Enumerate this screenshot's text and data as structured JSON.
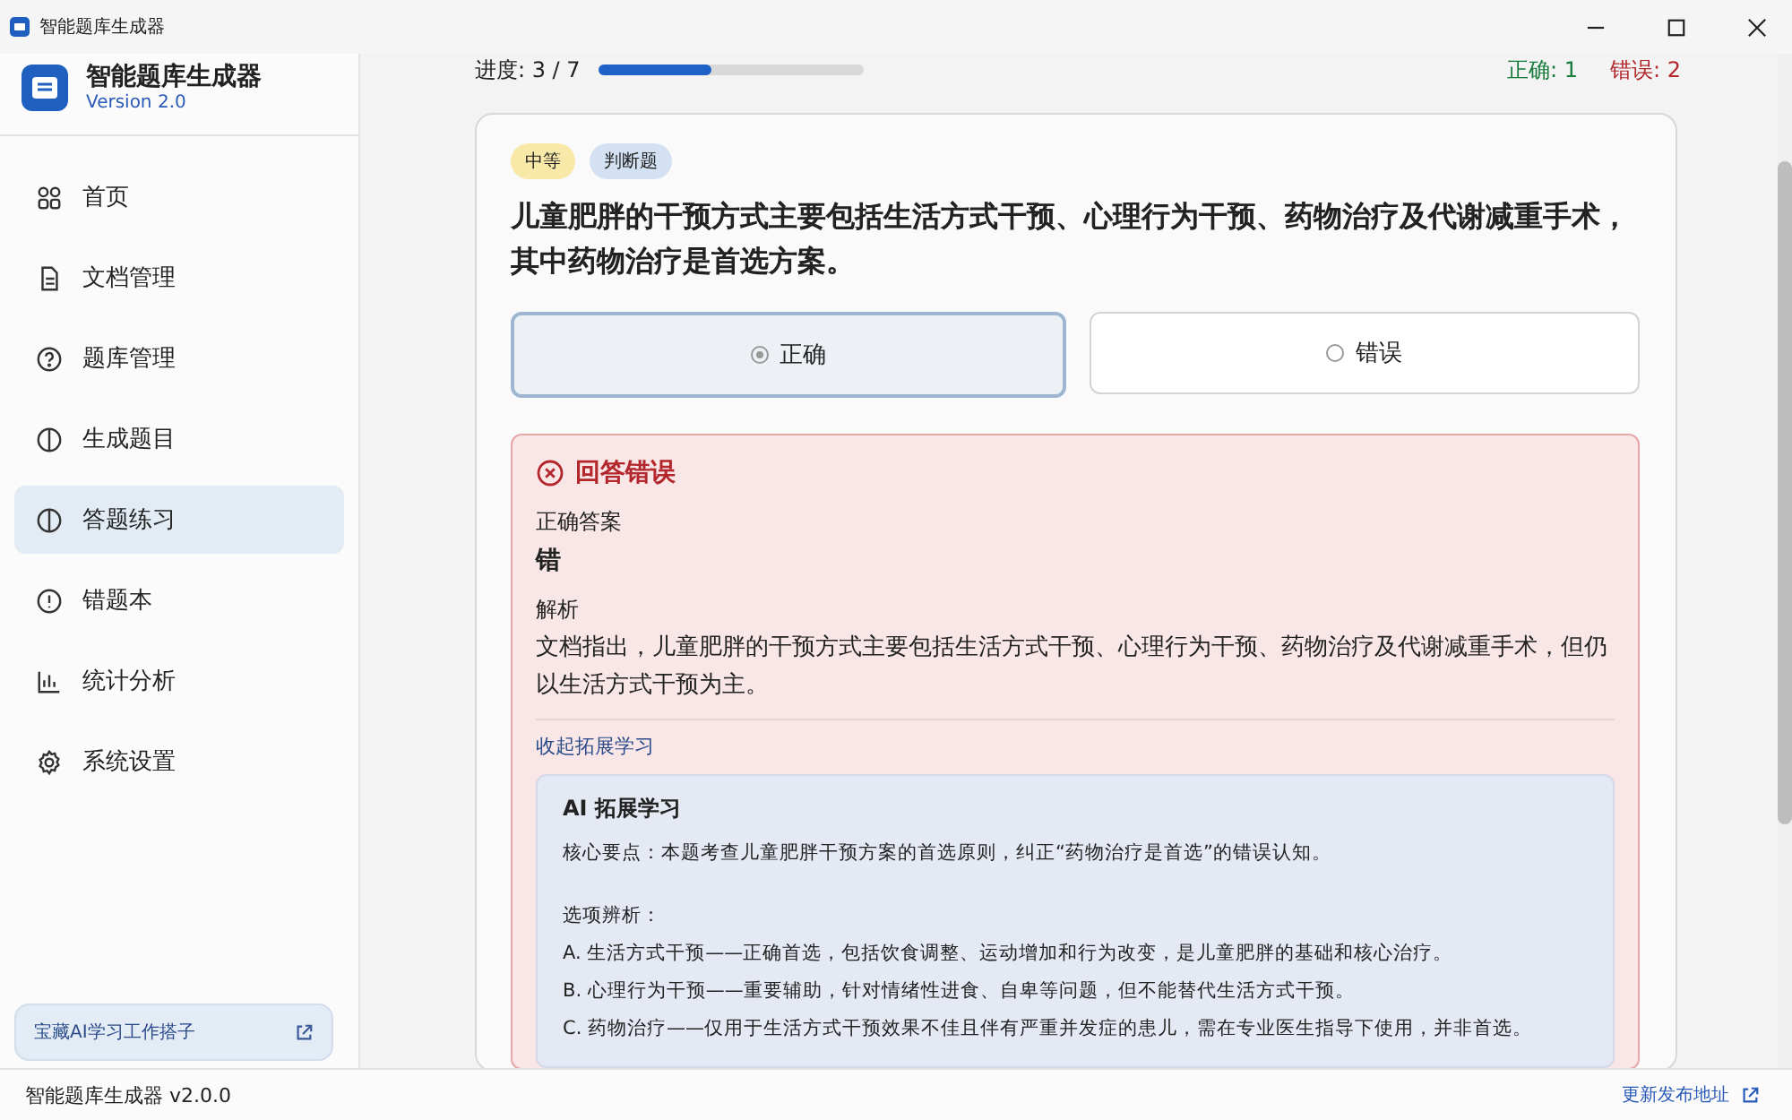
{
  "window": {
    "title": "智能题库生成器"
  },
  "sidebar": {
    "app_name": "智能题库生成器",
    "version": "Version 2.0",
    "items": [
      {
        "label": "首页",
        "kind": "grid",
        "selected": false
      },
      {
        "label": "文档管理",
        "kind": "doc",
        "selected": false
      },
      {
        "label": "题库管理",
        "kind": "help",
        "selected": false
      },
      {
        "label": "生成题目",
        "kind": "half",
        "selected": false
      },
      {
        "label": "答题练习",
        "kind": "half",
        "selected": true
      },
      {
        "label": "错题本",
        "kind": "alert",
        "selected": false
      },
      {
        "label": "统计分析",
        "kind": "chart",
        "selected": false
      },
      {
        "label": "系统设置",
        "kind": "gear",
        "selected": false
      }
    ],
    "promo_link": "宝藏AI学习工作搭子"
  },
  "progress": {
    "label": "进度: 3 / 7",
    "level": 0.43,
    "correct": "正确: 1",
    "wrong": "错误: 2"
  },
  "question": {
    "tags": [
      {
        "label": "中等",
        "color": "#f8e9a8"
      },
      {
        "label": "判断题",
        "color": "#d3e1f3"
      }
    ],
    "text": "儿童肥胖的干预方式主要包括生活方式干预、心理行为干预、药物治疗及代谢减重手术，其中药物治疗是首选方案。",
    "options": [
      {
        "label": "正确",
        "selected": true
      },
      {
        "label": "错误",
        "selected": false
      }
    ]
  },
  "feedback": {
    "result": "回答错误",
    "answer_label": "正确答案",
    "answer": "错",
    "analysis_label": "解析",
    "analysis": "文档指出，儿童肥胖的干预方式主要包括生活方式干预、心理行为干预、药物治疗及代谢减重手术，但仍以生活方式干预为主。",
    "toggle": "收起拓展学习",
    "ai": {
      "title": "AI 拓展学习",
      "summary": "核心要点：本题考查儿童肥胖干预方案的首选原则，纠正“药物治疗是首选”的错误认知。",
      "lines": [
        "选项辨析：",
        "A. 生活方式干预——正确首选，包括饮食调整、运动增加和行为改变，是儿童肥胖的基础和核心治疗。",
        "B. 心理行为干预——重要辅助，针对情绪性进食、自卑等问题，但不能替代生活方式干预。",
        "C. 药物治疗——仅用于生活方式干预效果不佳且伴有严重并发症的患儿，需在专业医生指导下使用，并非首选。"
      ]
    }
  },
  "status_bar": {
    "version": "智能题库生成器 v2.0.0",
    "link": "更新发布地址"
  }
}
